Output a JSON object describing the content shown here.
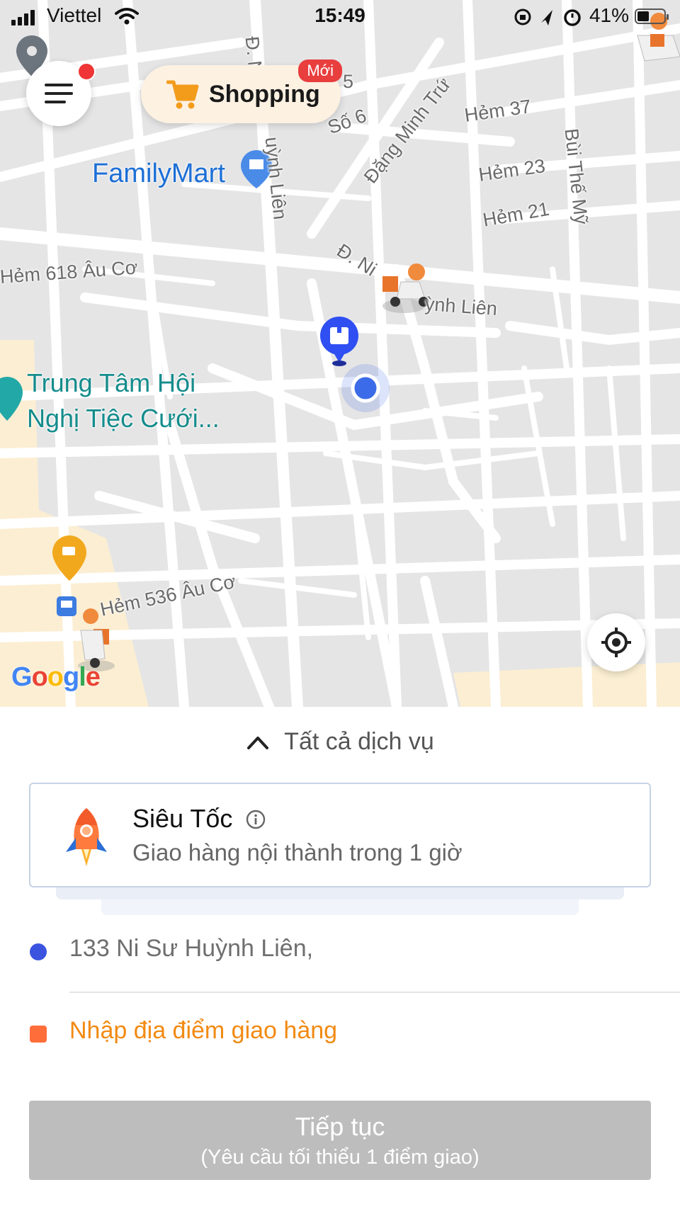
{
  "status_bar": {
    "carrier": "Viettel",
    "time": "15:49",
    "battery_percent": "41%"
  },
  "map": {
    "shopping_label": "Shopping",
    "new_badge": "Mới",
    "poi_familymart": "FamilyMart",
    "poi_wedding_line1": "Trung Tâm Hội",
    "poi_wedding_line2": "Nghị Tiệc Cưới...",
    "street_labels": {
      "dang_minh_tru": "Đặng Minh Trứ",
      "hem_37": "Hẻm 37",
      "hem_23": "Hẻm 23",
      "hem_21": "Hẻm 21",
      "bui_the_my": "Bùi Thế Mỹ",
      "so_6": "Số 6",
      "so_5": "5",
      "d_ni_vertical": "Đ. Ni",
      "huynh_lien_vertical": "uỳnh Liên",
      "d_ni_diag": "Đ. Ni",
      "huynh_lien_diag": "ỳnh Liên",
      "hem_618": "Hẻm 618 Âu Cơ",
      "hem_536": "Hẻm 536 Âu Cơ"
    },
    "google_logo": "Google"
  },
  "sheet": {
    "all_services": "Tất cả dịch vụ",
    "service": {
      "name": "Siêu Tốc",
      "description": "Giao hàng nội thành trong 1 giờ"
    },
    "pickup_address": "133 Ni Sư Huỳnh Liên,",
    "dropoff_placeholder": "Nhập địa điểm giao hàng",
    "continue_label": "Tiếp tục",
    "continue_note": "(Yêu cầu tối thiểu 1 điểm giao)"
  },
  "colors": {
    "accent_orange": "#f28a12",
    "pickup_blue": "#3a54e0",
    "dropoff_orange": "#ff6e3a",
    "disabled_button": "#bdbdbd",
    "badge_red": "#e93e3e"
  },
  "icons": [
    "menu-icon",
    "cart-icon",
    "locate-icon",
    "rocket-icon",
    "info-icon",
    "chevron-up-icon",
    "parcel-pin-icon",
    "current-location-icon"
  ]
}
